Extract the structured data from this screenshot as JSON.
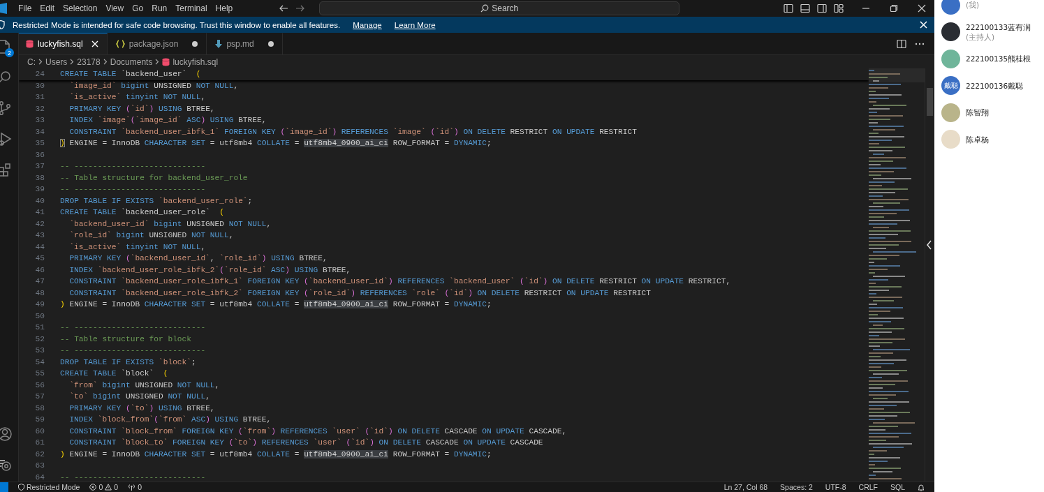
{
  "menu": [
    "File",
    "Edit",
    "Selection",
    "View",
    "Go",
    "Run",
    "Terminal",
    "Help"
  ],
  "search": {
    "label": "Search"
  },
  "banner": {
    "text": "Restricted Mode is intended for safe code browsing. Trust this window to enable all features.",
    "links": [
      "Manage",
      "Learn More"
    ]
  },
  "activity_bar": {
    "explorer_badge": "2"
  },
  "tabs": [
    {
      "label": "luckyfish.sql",
      "kind": "sql",
      "selected": true,
      "modified": false
    },
    {
      "label": "package.json",
      "kind": "json",
      "selected": false,
      "modified": true
    },
    {
      "label": "psp.md",
      "kind": "markdown",
      "selected": false,
      "modified": true
    }
  ],
  "breadcrumb": [
    "C:",
    "Users",
    "23178",
    "Documents",
    "luckyfish.sql"
  ],
  "sticky_line": {
    "number": "24",
    "tokens": [
      {
        "kind": "keyword",
        "text": "CREATE TABLE "
      },
      {
        "kind": "plain",
        "text": "`backend_user`  "
      },
      {
        "kind": "bracket",
        "text": "("
      }
    ]
  },
  "code_lines": [
    {
      "number": "30",
      "indented": true,
      "tokens": [
        {
          "kind": "identifier",
          "text": "`image_id` "
        },
        {
          "kind": "keyword",
          "text": "bigint"
        },
        {
          "kind": "plain",
          "text": " UNSIGNED "
        },
        {
          "kind": "keyword",
          "text": "NOT NULL"
        },
        {
          "kind": "plain",
          "text": ","
        }
      ]
    },
    {
      "number": "31",
      "indented": true,
      "tokens": [
        {
          "kind": "identifier",
          "text": "`is_active` "
        },
        {
          "kind": "keyword",
          "text": "tinyint NOT NULL"
        },
        {
          "kind": "plain",
          "text": ","
        }
      ]
    },
    {
      "number": "32",
      "indented": true,
      "tokens": [
        {
          "kind": "keyword",
          "text": "PRIMARY KEY "
        },
        {
          "kind": "bracket-inner",
          "text": "("
        },
        {
          "kind": "identifier",
          "text": "`id`"
        },
        {
          "kind": "bracket-inner",
          "text": ")"
        },
        {
          "kind": "keyword",
          "text": " USING"
        },
        {
          "kind": "plain",
          "text": " BTREE,"
        }
      ]
    },
    {
      "number": "33",
      "indented": true,
      "tokens": [
        {
          "kind": "keyword",
          "text": "INDEX "
        },
        {
          "kind": "identifier",
          "text": "`image`"
        },
        {
          "kind": "bracket-inner",
          "text": "("
        },
        {
          "kind": "identifier",
          "text": "`image_id` "
        },
        {
          "kind": "keyword",
          "text": "ASC"
        },
        {
          "kind": "bracket-inner",
          "text": ")"
        },
        {
          "kind": "keyword",
          "text": " USING"
        },
        {
          "kind": "plain",
          "text": " BTREE,"
        }
      ]
    },
    {
      "number": "34",
      "indented": true,
      "tokens": [
        {
          "kind": "keyword",
          "text": "CONSTRAINT "
        },
        {
          "kind": "identifier",
          "text": "`backend_user_ibfk_1` "
        },
        {
          "kind": "keyword",
          "text": "FOREIGN KEY "
        },
        {
          "kind": "bracket-inner",
          "text": "("
        },
        {
          "kind": "identifier",
          "text": "`image_id`"
        },
        {
          "kind": "bracket-inner",
          "text": ")"
        },
        {
          "kind": "keyword",
          "text": " REFERENCES "
        },
        {
          "kind": "identifier",
          "text": "`image` "
        },
        {
          "kind": "bracket-inner",
          "text": "("
        },
        {
          "kind": "identifier",
          "text": "`id`"
        },
        {
          "kind": "bracket-inner",
          "text": ")"
        },
        {
          "kind": "keyword",
          "text": " ON DELETE"
        },
        {
          "kind": "plain",
          "text": " RESTRICT "
        },
        {
          "kind": "keyword",
          "text": "ON UPDATE"
        },
        {
          "kind": "plain",
          "text": " RESTRICT"
        }
      ]
    },
    {
      "number": "35",
      "tokens": [
        {
          "kind": "bracket-match",
          "text": ")"
        },
        {
          "kind": "plain",
          "text": " ENGINE = InnoDB "
        },
        {
          "kind": "keyword",
          "text": "CHARACTER SET"
        },
        {
          "kind": "plain",
          "text": " = utf8mb4 "
        },
        {
          "kind": "keyword",
          "text": "COLLATE"
        },
        {
          "kind": "plain",
          "text": " = "
        },
        {
          "kind": "highlight",
          "text": "utf8mb4_0900_ai_ci"
        },
        {
          "kind": "plain",
          "text": " ROW_FORMAT = "
        },
        {
          "kind": "keyword",
          "text": "DYNAMIC"
        },
        {
          "kind": "plain",
          "text": ";"
        }
      ]
    },
    {
      "number": "36"
    },
    {
      "number": "37",
      "tokens": [
        {
          "kind": "comment",
          "text": "-- ----------------------------"
        }
      ]
    },
    {
      "number": "38",
      "tokens": [
        {
          "kind": "comment",
          "text": "-- Table structure for backend_user_role"
        }
      ]
    },
    {
      "number": "39",
      "tokens": [
        {
          "kind": "comment",
          "text": "-- ----------------------------"
        }
      ]
    },
    {
      "number": "40",
      "tokens": [
        {
          "kind": "keyword",
          "text": "DROP TABLE IF EXISTS "
        },
        {
          "kind": "identifier",
          "text": "`backend_user_role`"
        },
        {
          "kind": "plain",
          "text": ";"
        }
      ]
    },
    {
      "number": "41",
      "tokens": [
        {
          "kind": "keyword",
          "text": "CREATE TABLE "
        },
        {
          "kind": "plain",
          "text": "`backend_user_role`  "
        },
        {
          "kind": "bracket",
          "text": "("
        }
      ]
    },
    {
      "number": "42",
      "indented": true,
      "tokens": [
        {
          "kind": "identifier",
          "text": "`backend_user_id` "
        },
        {
          "kind": "keyword",
          "text": "bigint"
        },
        {
          "kind": "plain",
          "text": " UNSIGNED "
        },
        {
          "kind": "keyword",
          "text": "NOT NULL"
        },
        {
          "kind": "plain",
          "text": ","
        }
      ]
    },
    {
      "number": "43",
      "indented": true,
      "tokens": [
        {
          "kind": "identifier",
          "text": "`role_id` "
        },
        {
          "kind": "keyword",
          "text": "bigint"
        },
        {
          "kind": "plain",
          "text": " UNSIGNED "
        },
        {
          "kind": "keyword",
          "text": "NOT NULL"
        },
        {
          "kind": "plain",
          "text": ","
        }
      ]
    },
    {
      "number": "44",
      "indented": true,
      "tokens": [
        {
          "kind": "identifier",
          "text": "`is_active` "
        },
        {
          "kind": "keyword",
          "text": "tinyint NOT NULL"
        },
        {
          "kind": "plain",
          "text": ","
        }
      ]
    },
    {
      "number": "45",
      "indented": true,
      "tokens": [
        {
          "kind": "keyword",
          "text": "PRIMARY KEY "
        },
        {
          "kind": "bracket-inner",
          "text": "("
        },
        {
          "kind": "identifier",
          "text": "`backend_user_id`"
        },
        {
          "kind": "plain",
          "text": ", "
        },
        {
          "kind": "identifier",
          "text": "`role_id`"
        },
        {
          "kind": "bracket-inner",
          "text": ")"
        },
        {
          "kind": "keyword",
          "text": " USING"
        },
        {
          "kind": "plain",
          "text": " BTREE,"
        }
      ]
    },
    {
      "number": "46",
      "indented": true,
      "tokens": [
        {
          "kind": "keyword",
          "text": "INDEX "
        },
        {
          "kind": "identifier",
          "text": "`backend_user_role_ibfk_2`"
        },
        {
          "kind": "bracket-inner",
          "text": "("
        },
        {
          "kind": "identifier",
          "text": "`role_id` "
        },
        {
          "kind": "keyword",
          "text": "ASC"
        },
        {
          "kind": "bracket-inner",
          "text": ")"
        },
        {
          "kind": "keyword",
          "text": " USING"
        },
        {
          "kind": "plain",
          "text": " BTREE,"
        }
      ]
    },
    {
      "number": "47",
      "indented": true,
      "tokens": [
        {
          "kind": "keyword",
          "text": "CONSTRAINT "
        },
        {
          "kind": "identifier",
          "text": "`backend_user_role_ibfk_1` "
        },
        {
          "kind": "keyword",
          "text": "FOREIGN KEY "
        },
        {
          "kind": "bracket-inner",
          "text": "("
        },
        {
          "kind": "identifier",
          "text": "`backend_user_id`"
        },
        {
          "kind": "bracket-inner",
          "text": ")"
        },
        {
          "kind": "keyword",
          "text": " REFERENCES "
        },
        {
          "kind": "identifier",
          "text": "`backend_user` "
        },
        {
          "kind": "bracket-inner",
          "text": "("
        },
        {
          "kind": "identifier",
          "text": "`id`"
        },
        {
          "kind": "bracket-inner",
          "text": ")"
        },
        {
          "kind": "keyword",
          "text": " ON DELETE"
        },
        {
          "kind": "plain",
          "text": " RESTRICT "
        },
        {
          "kind": "keyword",
          "text": "ON UPDATE"
        },
        {
          "kind": "plain",
          "text": " RESTRICT,"
        }
      ]
    },
    {
      "number": "48",
      "indented": true,
      "tokens": [
        {
          "kind": "keyword",
          "text": "CONSTRAINT "
        },
        {
          "kind": "identifier",
          "text": "`backend_user_role_ibfk_2` "
        },
        {
          "kind": "keyword",
          "text": "FOREIGN KEY "
        },
        {
          "kind": "bracket-inner",
          "text": "("
        },
        {
          "kind": "identifier",
          "text": "`role_id`"
        },
        {
          "kind": "bracket-inner",
          "text": ")"
        },
        {
          "kind": "keyword",
          "text": " REFERENCES "
        },
        {
          "kind": "identifier",
          "text": "`role` "
        },
        {
          "kind": "bracket-inner",
          "text": "("
        },
        {
          "kind": "identifier",
          "text": "`id`"
        },
        {
          "kind": "bracket-inner",
          "text": ")"
        },
        {
          "kind": "keyword",
          "text": " ON DELETE"
        },
        {
          "kind": "plain",
          "text": " RESTRICT "
        },
        {
          "kind": "keyword",
          "text": "ON UPDATE"
        },
        {
          "kind": "plain",
          "text": " RESTRICT"
        }
      ]
    },
    {
      "number": "49",
      "tokens": [
        {
          "kind": "bracket",
          "text": ")"
        },
        {
          "kind": "plain",
          "text": " ENGINE = InnoDB "
        },
        {
          "kind": "keyword",
          "text": "CHARACTER SET"
        },
        {
          "kind": "plain",
          "text": " = utf8mb4 "
        },
        {
          "kind": "keyword",
          "text": "COLLATE"
        },
        {
          "kind": "plain",
          "text": " = "
        },
        {
          "kind": "highlight",
          "text": "utf8mb4_0900_ai_ci"
        },
        {
          "kind": "plain",
          "text": " ROW_FORMAT = "
        },
        {
          "kind": "keyword",
          "text": "DYNAMIC"
        },
        {
          "kind": "plain",
          "text": ";"
        }
      ]
    },
    {
      "number": "50"
    },
    {
      "number": "51",
      "tokens": [
        {
          "kind": "comment",
          "text": "-- ----------------------------"
        }
      ]
    },
    {
      "number": "52",
      "tokens": [
        {
          "kind": "comment",
          "text": "-- Table structure for block"
        }
      ]
    },
    {
      "number": "53",
      "tokens": [
        {
          "kind": "comment",
          "text": "-- ----------------------------"
        }
      ]
    },
    {
      "number": "54",
      "tokens": [
        {
          "kind": "keyword",
          "text": "DROP TABLE IF EXISTS "
        },
        {
          "kind": "identifier",
          "text": "`block`"
        },
        {
          "kind": "plain",
          "text": ";"
        }
      ]
    },
    {
      "number": "55",
      "tokens": [
        {
          "kind": "keyword",
          "text": "CREATE TABLE "
        },
        {
          "kind": "plain",
          "text": "`block`  "
        },
        {
          "kind": "bracket",
          "text": "("
        }
      ]
    },
    {
      "number": "56",
      "indented": true,
      "tokens": [
        {
          "kind": "identifier",
          "text": "`from` "
        },
        {
          "kind": "keyword",
          "text": "bigint"
        },
        {
          "kind": "plain",
          "text": " UNSIGNED "
        },
        {
          "kind": "keyword",
          "text": "NOT NULL"
        },
        {
          "kind": "plain",
          "text": ","
        }
      ]
    },
    {
      "number": "57",
      "indented": true,
      "tokens": [
        {
          "kind": "identifier",
          "text": "`to` "
        },
        {
          "kind": "keyword",
          "text": "bigint"
        },
        {
          "kind": "plain",
          "text": " UNSIGNED "
        },
        {
          "kind": "keyword",
          "text": "NOT NULL"
        },
        {
          "kind": "plain",
          "text": ","
        }
      ]
    },
    {
      "number": "58",
      "indented": true,
      "tokens": [
        {
          "kind": "keyword",
          "text": "PRIMARY KEY "
        },
        {
          "kind": "bracket-inner",
          "text": "("
        },
        {
          "kind": "identifier",
          "text": "`to`"
        },
        {
          "kind": "bracket-inner",
          "text": ")"
        },
        {
          "kind": "keyword",
          "text": " USING"
        },
        {
          "kind": "plain",
          "text": " BTREE,"
        }
      ]
    },
    {
      "number": "59",
      "indented": true,
      "tokens": [
        {
          "kind": "keyword",
          "text": "INDEX "
        },
        {
          "kind": "identifier",
          "text": "`block_from`"
        },
        {
          "kind": "bracket-inner",
          "text": "("
        },
        {
          "kind": "identifier",
          "text": "`from` "
        },
        {
          "kind": "keyword",
          "text": "ASC"
        },
        {
          "kind": "bracket-inner",
          "text": ")"
        },
        {
          "kind": "keyword",
          "text": " USING"
        },
        {
          "kind": "plain",
          "text": " BTREE,"
        }
      ]
    },
    {
      "number": "60",
      "indented": true,
      "tokens": [
        {
          "kind": "keyword",
          "text": "CONSTRAINT "
        },
        {
          "kind": "identifier",
          "text": "`block_from` "
        },
        {
          "kind": "keyword",
          "text": "FOREIGN KEY "
        },
        {
          "kind": "bracket-inner",
          "text": "("
        },
        {
          "kind": "identifier",
          "text": "`from`"
        },
        {
          "kind": "bracket-inner",
          "text": ")"
        },
        {
          "kind": "keyword",
          "text": " REFERENCES "
        },
        {
          "kind": "identifier",
          "text": "`user` "
        },
        {
          "kind": "bracket-inner",
          "text": "("
        },
        {
          "kind": "identifier",
          "text": "`id`"
        },
        {
          "kind": "bracket-inner",
          "text": ")"
        },
        {
          "kind": "keyword",
          "text": " ON DELETE"
        },
        {
          "kind": "plain",
          "text": " CASCADE "
        },
        {
          "kind": "keyword",
          "text": "ON UPDATE"
        },
        {
          "kind": "plain",
          "text": " CASCADE,"
        }
      ]
    },
    {
      "number": "61",
      "indented": true,
      "tokens": [
        {
          "kind": "keyword",
          "text": "CONSTRAINT "
        },
        {
          "kind": "identifier",
          "text": "`block_to` "
        },
        {
          "kind": "keyword",
          "text": "FOREIGN KEY "
        },
        {
          "kind": "bracket-inner",
          "text": "("
        },
        {
          "kind": "identifier",
          "text": "`to`"
        },
        {
          "kind": "bracket-inner",
          "text": ")"
        },
        {
          "kind": "keyword",
          "text": " REFERENCES "
        },
        {
          "kind": "identifier",
          "text": "`user` "
        },
        {
          "kind": "bracket-inner",
          "text": "("
        },
        {
          "kind": "identifier",
          "text": "`id`"
        },
        {
          "kind": "bracket-inner",
          "text": ")"
        },
        {
          "kind": "keyword",
          "text": " ON DELETE"
        },
        {
          "kind": "plain",
          "text": " CASCADE "
        },
        {
          "kind": "keyword",
          "text": "ON UPDATE"
        },
        {
          "kind": "plain",
          "text": " CASCADE"
        }
      ]
    },
    {
      "number": "62",
      "tokens": [
        {
          "kind": "bracket",
          "text": ")"
        },
        {
          "kind": "plain",
          "text": " ENGINE = InnoDB "
        },
        {
          "kind": "keyword",
          "text": "CHARACTER SET"
        },
        {
          "kind": "plain",
          "text": " = utf8mb4 "
        },
        {
          "kind": "keyword",
          "text": "COLLATE"
        },
        {
          "kind": "plain",
          "text": " = "
        },
        {
          "kind": "highlight",
          "text": "utf8mb4_0900_ai_ci"
        },
        {
          "kind": "plain",
          "text": " ROW_FORMAT = "
        },
        {
          "kind": "keyword",
          "text": "DYNAMIC"
        },
        {
          "kind": "plain",
          "text": ";"
        }
      ]
    },
    {
      "number": "63"
    },
    {
      "number": "64",
      "tokens": [
        {
          "kind": "comment",
          "text": "-- ----------------------------"
        }
      ]
    }
  ],
  "status_bar": {
    "restricted": "Restricted Mode",
    "errors": "0",
    "warnings": "0",
    "ports": "0",
    "right": [
      "Ln 27, Col 68",
      "Spaces: 2",
      "UTF-8",
      "CRLF",
      "SQL"
    ]
  },
  "participants": [
    {
      "role": "(我)",
      "color": "#3a6fc4"
    },
    {
      "name": "222100133蓝有润",
      "role": "(主持人)",
      "color": "#2a2d33"
    },
    {
      "name": "222100135熊桂根",
      "color": "#6fb59a"
    },
    {
      "name": "222100136戴聪",
      "avatar_text": "戴聪",
      "color": "#3a6fc4"
    },
    {
      "name": "陈智翔",
      "color": "#b9b48a"
    },
    {
      "name": "陈卓杨",
      "color": "#e8dcc8"
    }
  ]
}
